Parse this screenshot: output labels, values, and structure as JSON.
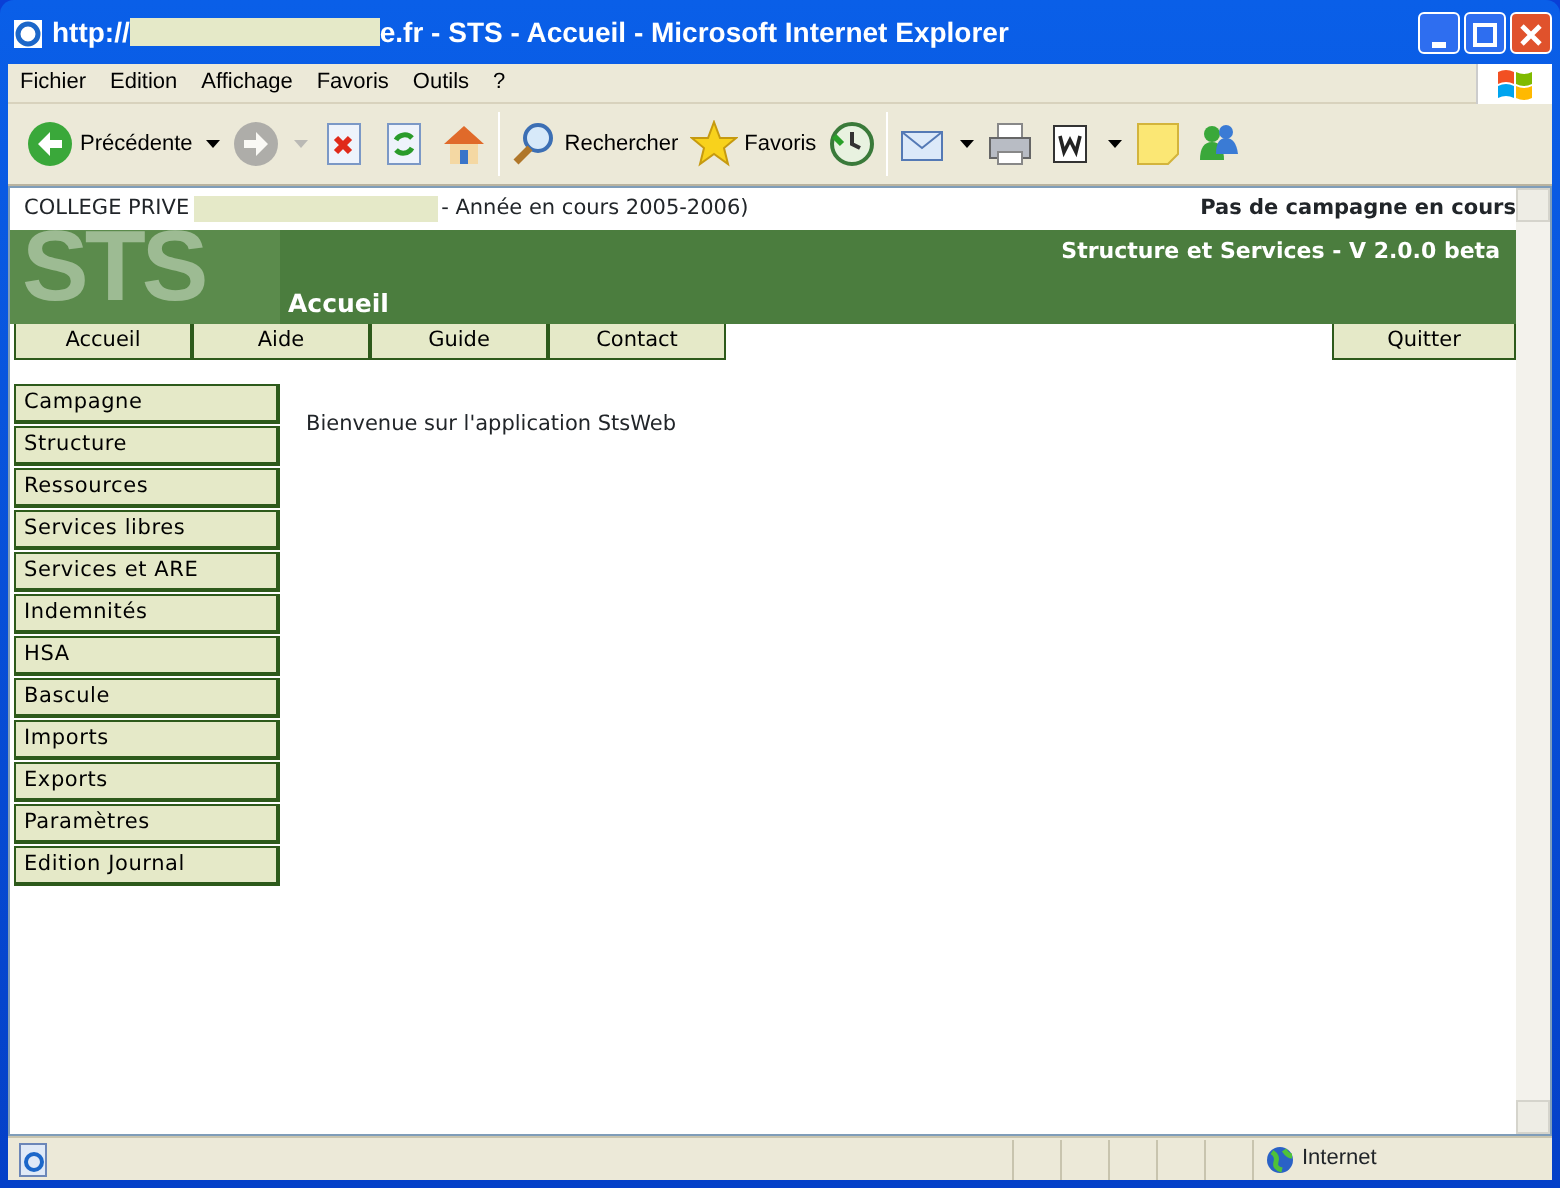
{
  "window": {
    "title_prefix": "http://",
    "title_suffix": "e.fr - STS - Accueil - Microsoft Internet Explorer"
  },
  "menu": [
    "Fichier",
    "Edition",
    "Affichage",
    "Favoris",
    "Outils",
    "?"
  ],
  "toolbar": [
    {
      "kind": "back",
      "label": "Précédente",
      "has_menu": true,
      "disabled": false
    },
    {
      "kind": "forward",
      "has_menu": true,
      "disabled": true
    },
    {
      "kind": "stop",
      "has_menu": false,
      "disabled": false
    },
    {
      "kind": "refresh",
      "has_menu": false,
      "disabled": false
    },
    {
      "kind": "home",
      "has_menu": false,
      "disabled": false
    },
    {
      "kind": "separator"
    },
    {
      "kind": "search",
      "label": "Rechercher",
      "has_menu": false,
      "disabled": false
    },
    {
      "kind": "favorites",
      "label": "Favoris",
      "has_menu": false,
      "disabled": false
    },
    {
      "kind": "history",
      "has_menu": false,
      "disabled": false
    },
    {
      "kind": "separator"
    },
    {
      "kind": "mail",
      "has_menu": true,
      "disabled": false
    },
    {
      "kind": "print",
      "has_menu": false,
      "disabled": false
    },
    {
      "kind": "edit",
      "has_menu": true,
      "disabled": false
    },
    {
      "kind": "note",
      "has_menu": false,
      "disabled": false
    },
    {
      "kind": "messenger",
      "has_menu": false,
      "disabled": false
    }
  ],
  "page": {
    "school_prefix": "COLLEGE PRIVE",
    "school_suffix": "- Année en cours 2005-2006)",
    "campaign": "Pas de campagne en cours",
    "logo": "STS",
    "app_title": "Structure et Services - V 2.0.0 beta",
    "section": "Accueil",
    "nav": [
      "Accueil",
      "Aide",
      "Guide",
      "Contact"
    ],
    "quit": "Quitter",
    "sidebar": [
      "Campagne",
      "Structure",
      "Ressources",
      "Services libres",
      "Services et ARE",
      "Indemnités",
      "HSA",
      "Bascule",
      "Imports",
      "Exports",
      "Paramètres",
      "Edition Journal"
    ],
    "welcome": "Bienvenue sur l'application StsWeb"
  },
  "status_bar": {
    "zone": "Internet"
  }
}
